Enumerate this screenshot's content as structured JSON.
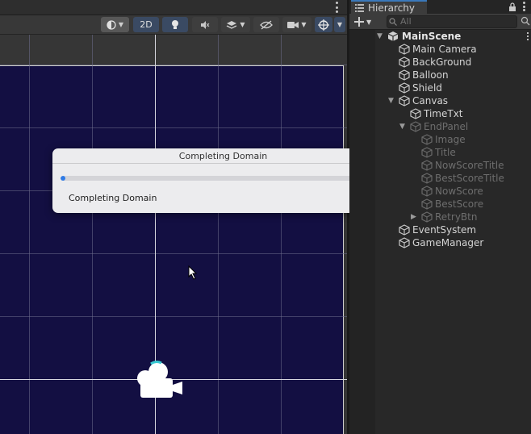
{
  "toolbar": {
    "btn_2d": "2D",
    "icons": [
      "shading-mode-icon",
      "2d-toggle",
      "lighting-icon",
      "audio-mute-icon",
      "effects-icon",
      "visibility-icon",
      "camera-icon",
      "gizmos-icon"
    ]
  },
  "dialog": {
    "title": "Completing Domain",
    "message": "Completing Domain",
    "progress": 0.01,
    "progress_color": "#2f7be6"
  },
  "scene": {
    "background": "#130f42"
  },
  "hierarchy": {
    "tab_label": "Hierarchy",
    "search_placeholder": "All",
    "scene_name": "MainScene",
    "items": [
      {
        "label": "Main Camera",
        "enabled": true
      },
      {
        "label": "BackGround",
        "enabled": true
      },
      {
        "label": "Balloon",
        "enabled": true
      },
      {
        "label": "Shield",
        "enabled": true
      },
      {
        "label": "Canvas",
        "enabled": true
      },
      {
        "label": "TimeTxt",
        "enabled": true
      },
      {
        "label": "EndPanel",
        "enabled": false
      },
      {
        "label": "Image",
        "enabled": false
      },
      {
        "label": "Title",
        "enabled": false
      },
      {
        "label": "NowScoreTitle",
        "enabled": false
      },
      {
        "label": "BestScoreTitle",
        "enabled": false
      },
      {
        "label": "NowScore",
        "enabled": false
      },
      {
        "label": "BestScore",
        "enabled": false
      },
      {
        "label": "RetryBtn",
        "enabled": false
      },
      {
        "label": "EventSystem",
        "enabled": true
      },
      {
        "label": "GameManager",
        "enabled": true
      }
    ]
  }
}
